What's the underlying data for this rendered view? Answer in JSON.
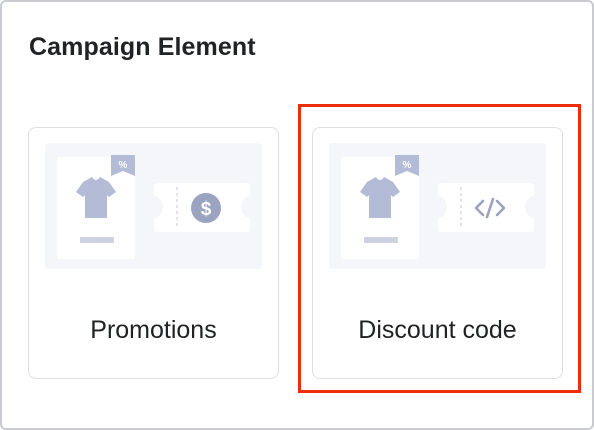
{
  "panel": {
    "title": "Campaign Element"
  },
  "cards": [
    {
      "label": "Promotions",
      "tag_text": "%",
      "ticket_icon": "dollar-icon"
    },
    {
      "label": "Discount code",
      "tag_text": "%",
      "ticket_icon": "code-icon"
    }
  ],
  "highlight": {
    "target": "Discount code",
    "color": "#ee2d0b"
  },
  "colors": {
    "illustration_bg": "#f5f6f9",
    "shirt": "#b3bbd6",
    "icon_accent": "#9aa3c0",
    "text": "#202223",
    "card_border": "#dcdee3"
  }
}
